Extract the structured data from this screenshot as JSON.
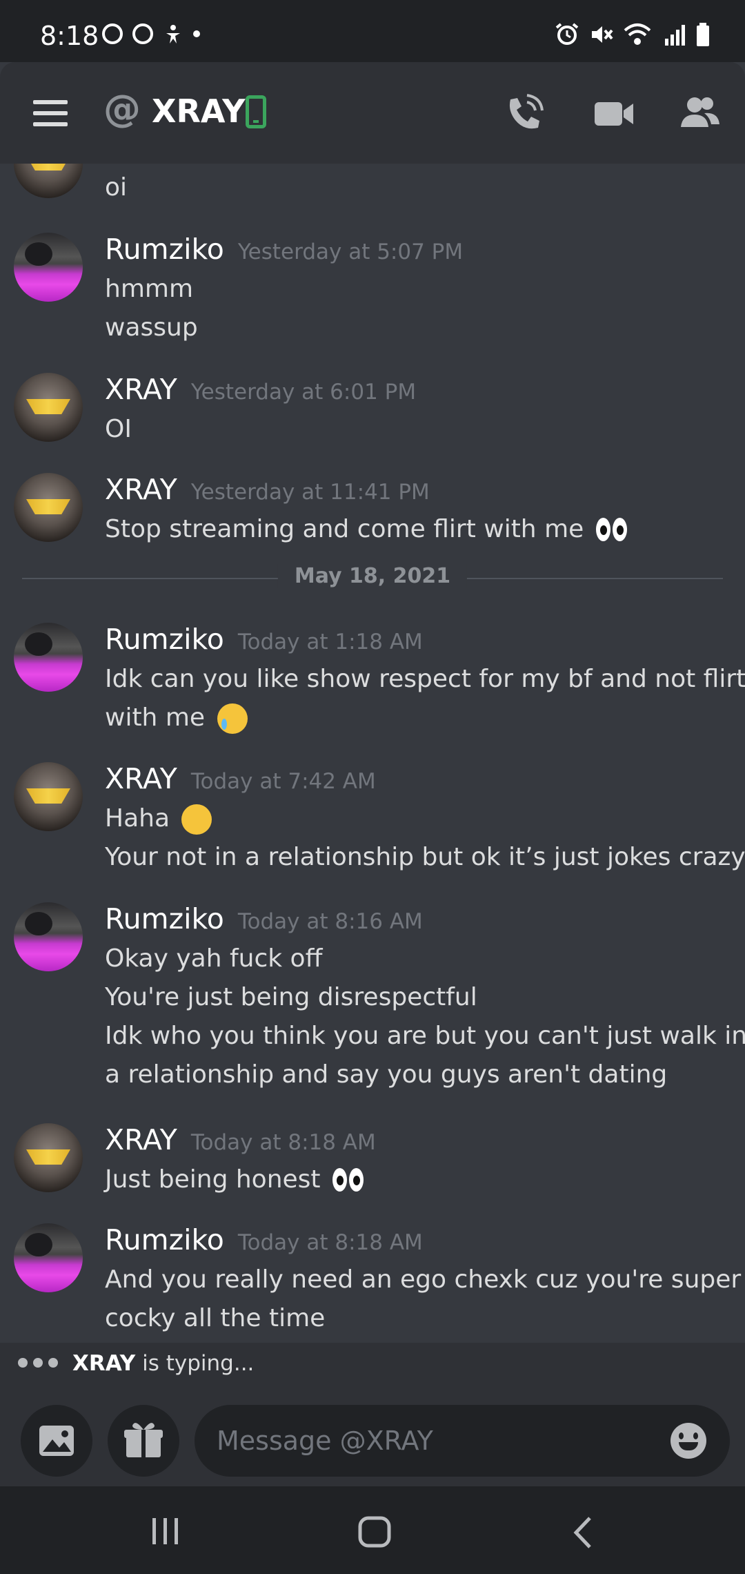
{
  "status_bar": {
    "time": "8:18"
  },
  "header": {
    "at_symbol": "@",
    "title": "XRAY"
  },
  "messages": [
    {
      "author": "",
      "timestamp": "",
      "lines": [
        "oi"
      ]
    },
    {
      "author": "Rumziko",
      "timestamp": "Yesterday at 5:07 PM",
      "lines": [
        "hmmm",
        "wassup"
      ]
    },
    {
      "author": "XRAY",
      "timestamp": "Yesterday at 6:01 PM",
      "lines": [
        "OI"
      ]
    },
    {
      "author": "XRAY",
      "timestamp": "Yesterday at 11:41 PM",
      "lines": [
        "Stop streaming and come flirt with me"
      ]
    },
    {
      "author": "Rumziko",
      "timestamp": "Today at 1:18 AM",
      "lines": [
        "Idk can you like show respect for my bf and not flirt",
        "with me"
      ]
    },
    {
      "author": "XRAY",
      "timestamp": "Today at 7:42 AM",
      "lines": [
        "Haha",
        "Your not in a relationship but ok it’s just jokes crazy"
      ]
    },
    {
      "author": "Rumziko",
      "timestamp": "Today at 8:16 AM",
      "lines": [
        "Okay yah fuck off",
        "You're just being disrespectful",
        "Idk who you think you are but you can't just walk into",
        "a relationship and say you guys aren't dating"
      ]
    },
    {
      "author": "XRAY",
      "timestamp": "Today at 8:18 AM",
      "lines": [
        "Just being honest"
      ]
    },
    {
      "author": "Rumziko",
      "timestamp": "Today at 8:18 AM",
      "lines": [
        "And you really need an ego chexk cuz you're super",
        "cocky all the time"
      ]
    }
  ],
  "date_divider": "May 18, 2021",
  "typing": {
    "user": "XRAY",
    "text": " is typing..."
  },
  "composer": {
    "placeholder": "Message @XRAY"
  },
  "icons": {
    "menu": "hamburger-menu-icon",
    "call": "phone-call-icon",
    "video": "video-camera-icon",
    "members": "members-icon",
    "image": "image-icon",
    "gift": "gift-icon",
    "emoji": "emoji-icon"
  },
  "colors": {
    "background": "#36393f",
    "header": "#2f3136",
    "input": "#202225",
    "online_mobile": "#3ba55d"
  }
}
